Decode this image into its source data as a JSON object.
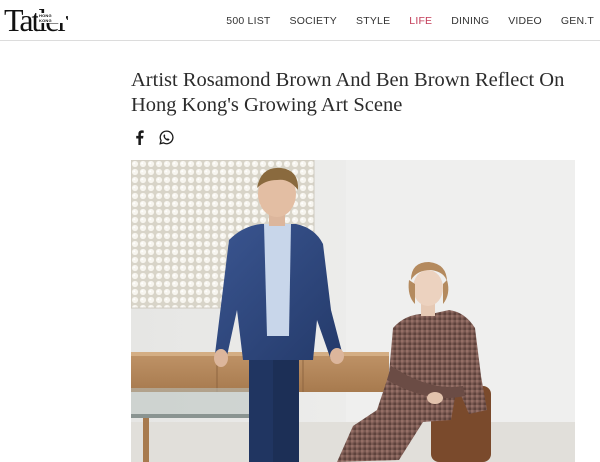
{
  "brand": {
    "logo_text": "Tatler",
    "logo_subtext": "HONG KONG"
  },
  "nav": {
    "items": [
      {
        "label": "500 LIST",
        "active": false
      },
      {
        "label": "SOCIETY",
        "active": false
      },
      {
        "label": "STYLE",
        "active": false
      },
      {
        "label": "LIFE",
        "active": true
      },
      {
        "label": "DINING",
        "active": false
      },
      {
        "label": "VIDEO",
        "active": false
      },
      {
        "label": "GEN.T",
        "active": false
      }
    ]
  },
  "article": {
    "headline": "Artist Rosamond Brown And Ben Brown Reflect On Hong Kong's Growing Art Scene"
  },
  "share": {
    "icons": [
      "facebook-icon",
      "whatsapp-icon"
    ]
  },
  "colors": {
    "active_nav": "#c23b57",
    "text": "#2b2b2b"
  }
}
